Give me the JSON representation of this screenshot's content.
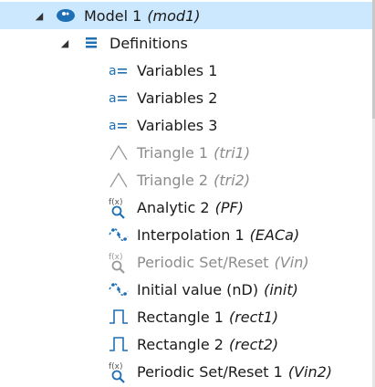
{
  "tree": {
    "model": {
      "label": "Model 1",
      "tag": "(mod1)",
      "icon": "model-icon"
    },
    "definitions": {
      "label": "Definitions",
      "icon": "definitions-list-icon"
    },
    "items": [
      {
        "label": "Variables 1",
        "tag": "",
        "icon": "variables-icon"
      },
      {
        "label": "Variables 2",
        "tag": "",
        "icon": "variables-icon"
      },
      {
        "label": "Variables 3",
        "tag": "",
        "icon": "variables-icon"
      },
      {
        "label": "Triangle 1",
        "tag": "(tri1)",
        "icon": "triangle-function-icon"
      },
      {
        "label": "Triangle 2",
        "tag": "(tri2)",
        "icon": "triangle-function-icon"
      },
      {
        "label": "Analytic 2",
        "tag": "(PF)",
        "icon": "analytic-function-icon"
      },
      {
        "label": "Interpolation 1",
        "tag": "(EACa)",
        "icon": "interpolation-function-icon"
      },
      {
        "label": "Periodic Set/Reset",
        "tag": "(Vin)",
        "icon": "analytic-function-icon"
      },
      {
        "label": "Initial value (nD)",
        "tag": "(init)",
        "icon": "interpolation-function-icon"
      },
      {
        "label": "Rectangle 1",
        "tag": "(rect1)",
        "icon": "rectangle-function-icon"
      },
      {
        "label": "Rectangle 2",
        "tag": "(rect2)",
        "icon": "rectangle-function-icon"
      },
      {
        "label": "Periodic Set/Reset 1",
        "tag": "(Vin2)",
        "icon": "analytic-function-icon"
      }
    ]
  },
  "colors": {
    "selection": "#cce8ff",
    "icon_blue": "#1f6fb5",
    "disabled_text": "#8c8c8c",
    "text": "#1a1a1a"
  }
}
